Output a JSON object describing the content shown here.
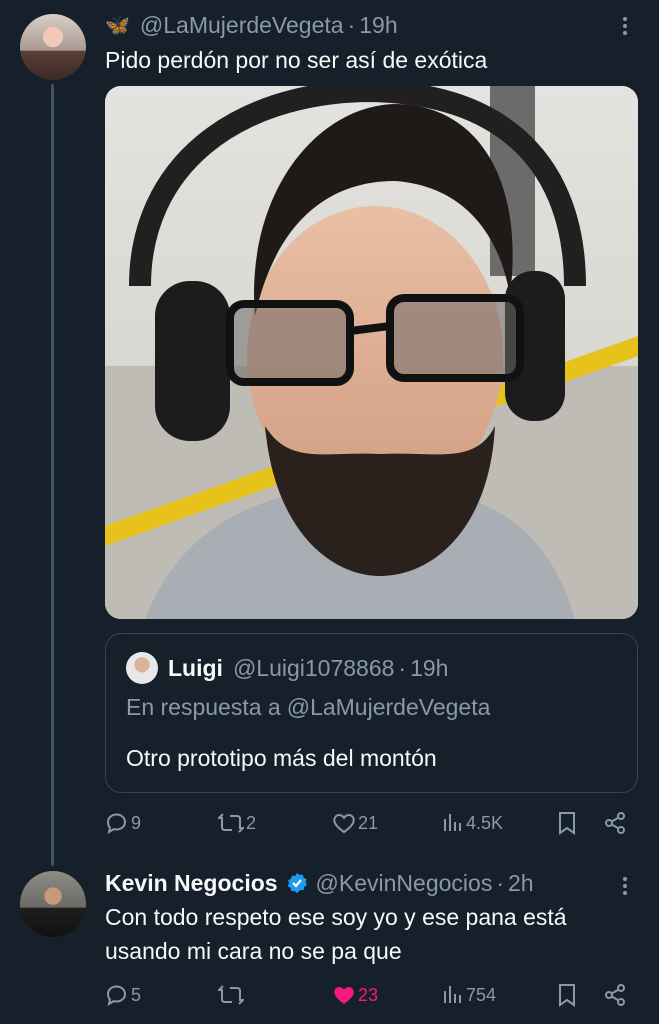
{
  "tweet1": {
    "emoji": "🦋",
    "handle": "@LaMujerdeVegeta",
    "time": "19h",
    "text": "Pido perdón por no ser así de exótica",
    "media_alt": "photo-man-headphones",
    "quote": {
      "name": "Luigi",
      "handle": "@Luigi1078868",
      "time": "19h",
      "reply_prefix": "En respuesta a",
      "reply_to": "@LaMujerdeVegeta",
      "text": "Otro prototipo más del montón"
    },
    "actions": {
      "replies": "9",
      "retweets": "2",
      "likes": "21",
      "views": "4.5K"
    }
  },
  "tweet2": {
    "name": "Kevin Negocios",
    "handle": "@KevinNegocios",
    "time": "2h",
    "text_line1": "Con todo respeto ese soy yo y ese pana está",
    "text_line2": "usando mi cara no se pa que",
    "actions": {
      "replies": "5",
      "retweets": "",
      "likes": "23",
      "views": "754"
    }
  },
  "colors": {
    "background": "#15202b",
    "muted": "#8b98a5",
    "like_active": "#f91880",
    "verified": "#1d9bf0"
  },
  "separator": "·"
}
